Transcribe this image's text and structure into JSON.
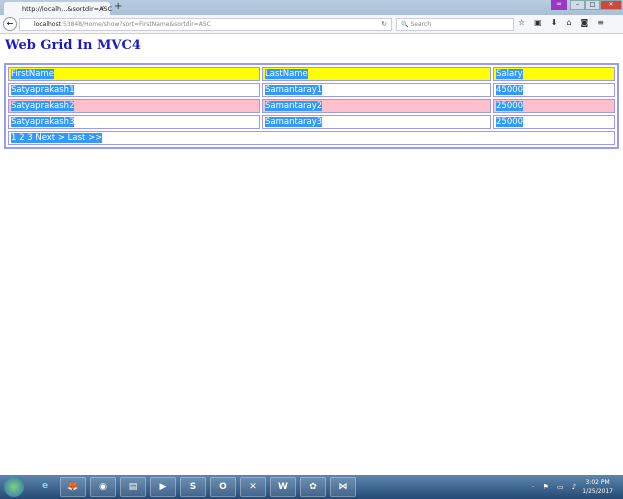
{
  "browser": {
    "tab_title": "http://localh...&sortdir=ASC",
    "url_host": "localhost",
    "url_rest": ":53848/Home/show?sort=FirstName&sortdir=ASC",
    "search_placeholder": "Search"
  },
  "page": {
    "title": "Web Grid In MVC4"
  },
  "grid": {
    "headers": [
      "FirstName",
      "LastName",
      "Salary"
    ],
    "rows": [
      [
        "Satyaprakash1",
        "Samantaray1",
        "45000"
      ],
      [
        "Satyaprakash2",
        "Samantaray2",
        "25000"
      ],
      [
        "Satyaprakash3",
        "Samantaray3",
        "25000"
      ]
    ],
    "pager": "1 2 3 Next > Last >>"
  },
  "taskbar": {
    "time": "3:02 PM",
    "date": "1/25/2017"
  },
  "colors": {
    "header": "#ffff00",
    "alt_row": "#ffc0cb",
    "border": "#9a9af0",
    "title": "#1a1acc"
  }
}
